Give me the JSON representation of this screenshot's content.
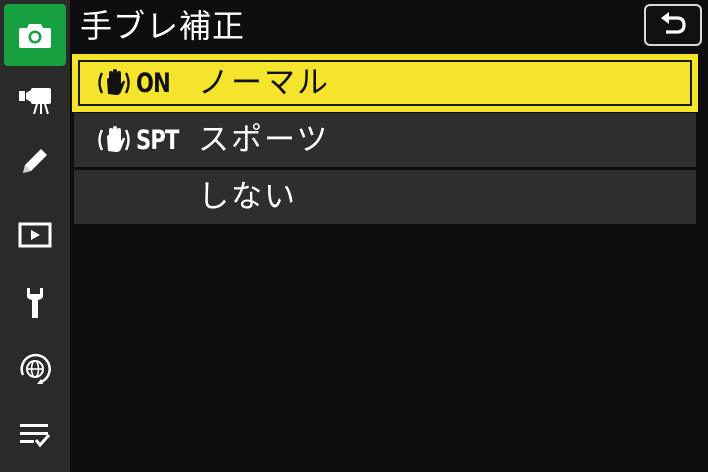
{
  "header": {
    "title": "手ブレ補正",
    "back_icon": "return-arrow-icon"
  },
  "sidebar": {
    "items": [
      {
        "icon": "camera-icon",
        "active": true
      },
      {
        "icon": "movie-camera-icon",
        "active": false
      },
      {
        "icon": "pencil-icon",
        "active": false
      },
      {
        "icon": "playback-icon",
        "active": false
      },
      {
        "icon": "wrench-icon",
        "active": false
      },
      {
        "icon": "network-globe-icon",
        "active": false
      },
      {
        "icon": "my-menu-list-icon",
        "active": false
      }
    ],
    "active_color": "#17a040"
  },
  "menu": {
    "options": [
      {
        "code": "ON",
        "icon": "vr-hand-icon",
        "label": "ノーマル",
        "selected": true
      },
      {
        "code": "SPT",
        "icon": "vr-hand-icon",
        "label": "スポーツ",
        "selected": false
      },
      {
        "code": "",
        "icon": "",
        "label": "しない",
        "selected": false
      }
    ],
    "highlight_color": "#f5e42c"
  }
}
